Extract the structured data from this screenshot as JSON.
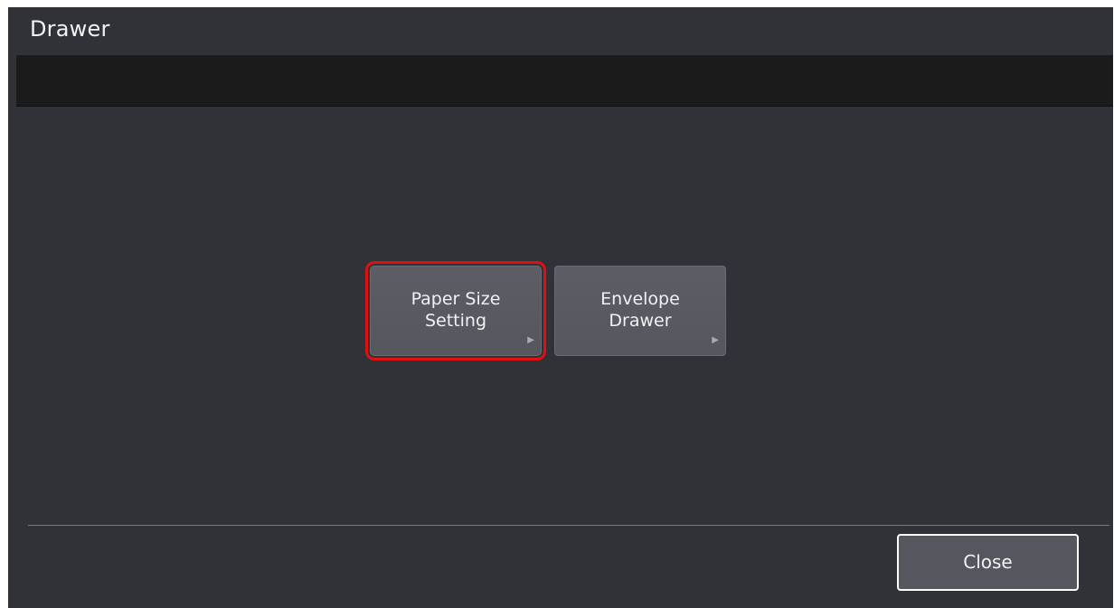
{
  "header": {
    "title": "Drawer"
  },
  "message_bar": {
    "text": ""
  },
  "menu": {
    "items": [
      {
        "label": "Paper Size\nSetting",
        "icon": "triangle-right-icon",
        "selected": true
      },
      {
        "label": "Envelope\nDrawer",
        "icon": "triangle-right-icon",
        "selected": false
      }
    ]
  },
  "footer": {
    "close_label": "Close"
  },
  "colors": {
    "background": "#313238",
    "button": "#55565e",
    "highlight": "#e01010"
  }
}
